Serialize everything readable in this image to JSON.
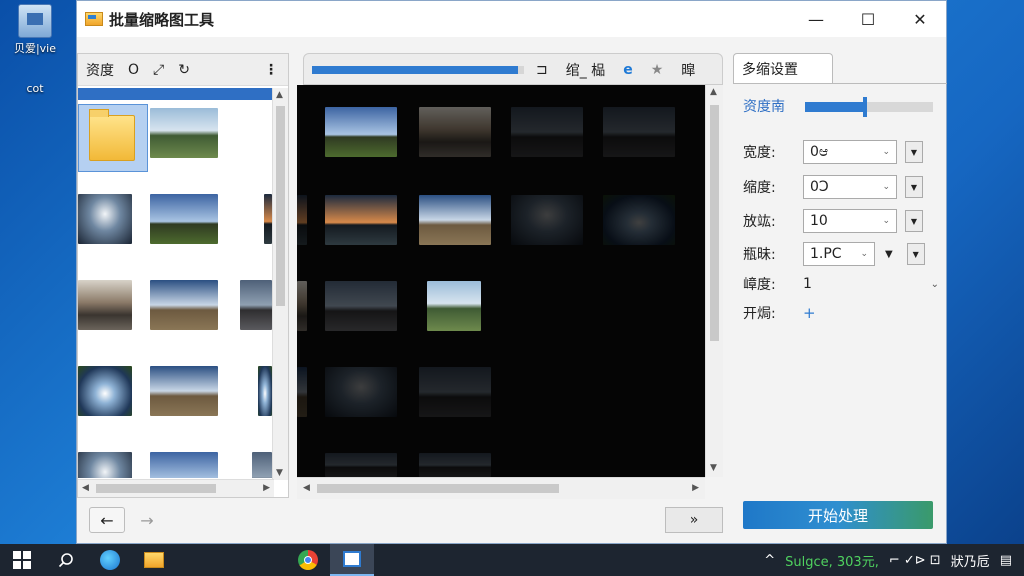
{
  "desktop": {
    "icon_label": "贝爱|vie",
    "icon_sub": "cot"
  },
  "window": {
    "title": "批量缩略图工具",
    "controls": [
      "—",
      "☐",
      "✕"
    ]
  },
  "left_panel": {
    "toolbar": {
      "label": "资度",
      "circle": "O",
      "expand": "⤢",
      "refresh": "↻",
      "more": "⋮"
    }
  },
  "middle_panel": {
    "progress_fraction": 0.97,
    "tools": {
      "t1": "⊐",
      "t2": "绾_ 榀",
      "ie": "e",
      "star": "★",
      "t5": "暭"
    }
  },
  "nav": {
    "back": "←",
    "forward": "→",
    "next": "»"
  },
  "settings": {
    "tab": "多缩设置",
    "quality_label": "资度南",
    "quality_fraction": 0.45,
    "rows": [
      {
        "label": "宽度:",
        "value": "0ಆ"
      },
      {
        "label": "缩度:",
        "value": "0Ↄ"
      },
      {
        "label": "放竑:",
        "value": "10"
      },
      {
        "label": "瓶昧:",
        "value": "1.PC"
      }
    ],
    "height_label": "嶂度:",
    "height_value": "1",
    "open_label": "开焗:",
    "open_add": "+",
    "start_button": "开始处理"
  },
  "taskbar": {
    "tray_text": "Sulgce, 303元,",
    "tray_icons": "⌐ ✓⊳ ⊡",
    "clock": "狀乃卮"
  },
  "colors": {
    "accent": "#2f7bd0",
    "taskbar": "#1d2530"
  }
}
